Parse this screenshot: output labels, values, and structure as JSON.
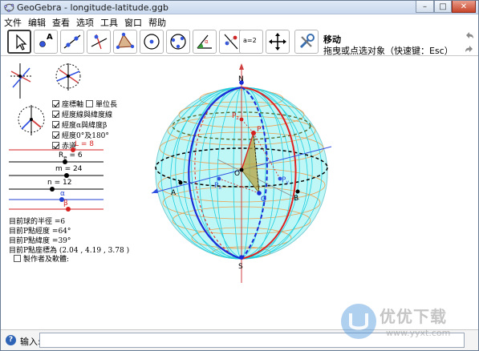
{
  "window": {
    "title": "GeoGebra - longitude-latitude.ggb",
    "controls": {
      "minimize": "–",
      "maximize": "□",
      "close": "✕"
    }
  },
  "menu": [
    "文件",
    "编辑",
    "查看",
    "选项",
    "工具",
    "窗口",
    "帮助"
  ],
  "toolbar": {
    "tools": [
      "move-tool-icon",
      "point-tool-icon",
      "line-tool-icon",
      "perpendicular-tool-icon",
      "polygon-tool-icon",
      "circle-tool-icon",
      "circle-three-points-tool-icon",
      "angle-tool-icon",
      "reflect-tool-icon",
      "slider-tool-icon",
      "move-view-tool-icon",
      "settings-tool-icon"
    ],
    "slider_tool_text": "a=2",
    "active_tool_title": "移动",
    "active_tool_help": "拖曳或点选对象（快速键：Esc）",
    "undo_icon": "undo-icon",
    "redo_icon": "redo-icon"
  },
  "algebra": {
    "checkboxes": [
      {
        "label": "座標軸",
        "checked": true
      },
      {
        "label": "單位長",
        "checked": false
      },
      {
        "label": "經度線與緯度線",
        "checked": true
      },
      {
        "label": "經度α與緯度β",
        "checked": true
      },
      {
        "label": "經度0°及180°",
        "checked": true
      },
      {
        "label": "赤道",
        "checked": true
      }
    ],
    "sliders": [
      {
        "name": "L = 8",
        "value": 8,
        "color": "#d62020"
      },
      {
        "name": "R",
        "sub": "e",
        "suffix": " = 6",
        "value": 6,
        "color": "#000000"
      },
      {
        "name": "m = 24",
        "value": 24,
        "color": "#000000"
      },
      {
        "name": "n = 12",
        "value": 12,
        "color": "#000000"
      },
      {
        "name": "α",
        "value": 64,
        "color": "#2040d0"
      },
      {
        "name": "β",
        "value": 39,
        "color": "#d62020"
      }
    ],
    "info_lines": [
      "目前球的半徑 =6",
      "目前P點經度 =64°",
      "目前P點緯度 =39°",
      "目前P點座標為 (2.04 , 4.19 , 3.78 )"
    ],
    "author_checkbox": {
      "label": "製作者及軟體:",
      "checked": false
    }
  },
  "sphere_labels": {
    "north": "N",
    "south": "S",
    "point_p": "P",
    "origin": "O",
    "px": "P",
    "px_sub": "x",
    "py": "P",
    "py_sub": "y",
    "pz": "P",
    "pz_sub": "z",
    "a": "A",
    "b": "B",
    "q": "Q"
  },
  "colors": {
    "sphere_fill": "#bff6f6",
    "latitude": "#f0a050",
    "longitude": "#20d0e0",
    "meridian_blue": "#1a2bd8",
    "meridian_red": "#e02020",
    "axis_red": "#d04040",
    "axis_blue": "#3050e0"
  },
  "input_bar": {
    "label": "输入:",
    "value": ""
  },
  "watermark": {
    "name": "优优下载",
    "url": "www.yyxt.com"
  }
}
